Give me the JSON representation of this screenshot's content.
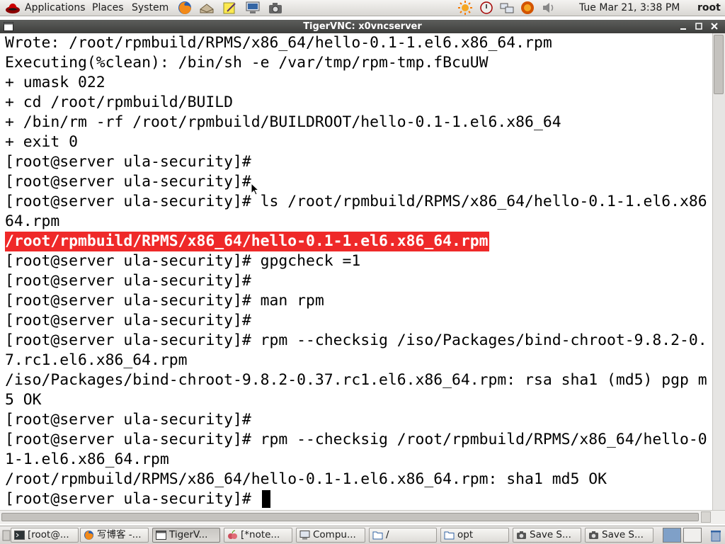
{
  "top_panel": {
    "menus": [
      "Applications",
      "Places",
      "System"
    ],
    "launchers": [
      "firefox-icon",
      "mail-icon",
      "notes-icon",
      "monitor-icon",
      "camera-icon"
    ],
    "tray": [
      "weather-icon",
      "update-icon",
      "network-icon",
      "firefox-icon",
      "volume-icon"
    ],
    "clock": "Tue Mar 21,  3:38 PM",
    "user": "root"
  },
  "window": {
    "title": "TigerVNC: x0vncserver"
  },
  "terminal": {
    "lines": [
      "Wrote: /root/rpmbuild/RPMS/x86_64/hello-0.1-1.el6.x86_64.rpm",
      "Executing(%clean): /bin/sh -e /var/tmp/rpm-tmp.fBcuUW",
      "+ umask 022",
      "+ cd /root/rpmbuild/BUILD",
      "+ /bin/rm -rf /root/rpmbuild/BUILDROOT/hello-0.1-1.el6.x86_64",
      "+ exit 0",
      "[root@server ula-security]#",
      "[root@server ula-security]#",
      "[root@server ula-security]# ls /root/rpmbuild/RPMS/x86_64/hello-0.1-1.el6.x86",
      "64.rpm",
      "/root/rpmbuild/RPMS/x86_64/hello-0.1-1.el6.x86_64.rpm",
      "[root@server ula-security]# gpgcheck =1",
      "[root@server ula-security]#",
      "[root@server ula-security]# man rpm",
      "[root@server ula-security]#",
      "[root@server ula-security]# rpm --checksig /iso/Packages/bind-chroot-9.8.2-0.",
      "7.rc1.el6.x86_64.rpm",
      "/iso/Packages/bind-chroot-9.8.2-0.37.rc1.el6.x86_64.rpm: rsa sha1 (md5) pgp m",
      "5 OK",
      "[root@server ula-security]#",
      "[root@server ula-security]# rpm --checksig /root/rpmbuild/RPMS/x86_64/hello-0",
      "1-1.el6.x86_64.rpm",
      "/root/rpmbuild/RPMS/x86_64/hello-0.1-1.el6.x86_64.rpm: sha1 md5 OK",
      "[root@server ula-security]# "
    ],
    "highlight_color": "#ef2929"
  },
  "taskbar": {
    "tasks": [
      {
        "label": "[root@...",
        "icon": "terminal-icon"
      },
      {
        "label": "写博客 -...",
        "icon": "firefox-icon"
      },
      {
        "label": "TigerV...",
        "icon": "window-icon"
      },
      {
        "label": "[*note...",
        "icon": "notes-icon"
      },
      {
        "label": "Compu...",
        "icon": "computer-icon"
      },
      {
        "label": "/",
        "icon": "folder-icon"
      },
      {
        "label": "opt",
        "icon": "folder-icon"
      },
      {
        "label": "Save S...",
        "icon": "camera-icon"
      },
      {
        "label": "Save S...",
        "icon": "camera-icon"
      }
    ]
  }
}
